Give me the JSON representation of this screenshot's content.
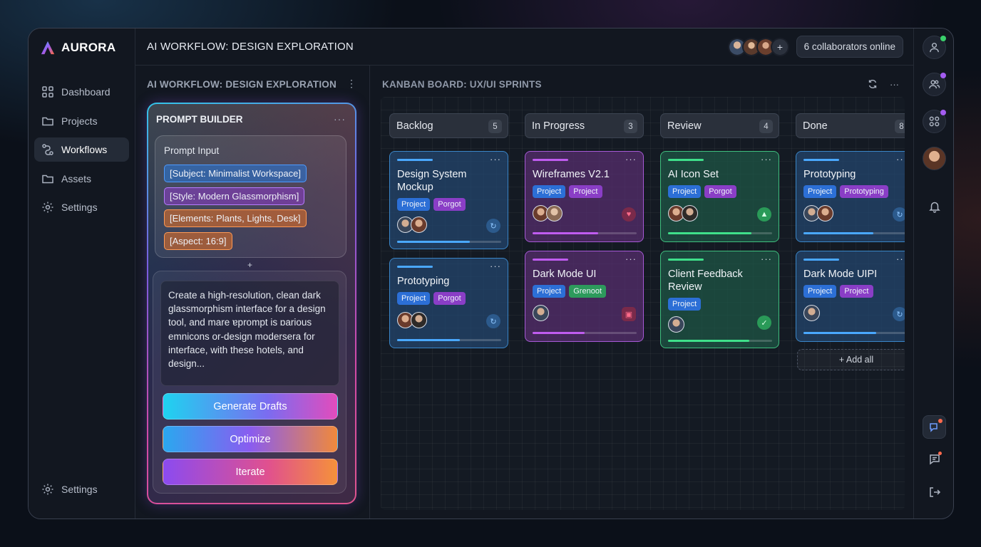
{
  "app": {
    "name": "AURORA"
  },
  "sidebar": {
    "items": [
      {
        "label": "Dashboard",
        "icon": "grid-icon"
      },
      {
        "label": "Projects",
        "icon": "folder-icon"
      },
      {
        "label": "Workflows",
        "icon": "workflow-icon",
        "active": true
      },
      {
        "label": "Assets",
        "icon": "folder-icon"
      },
      {
        "label": "Settings",
        "icon": "gear-icon"
      }
    ],
    "bottom": {
      "label": "Settings",
      "icon": "gear-icon"
    }
  },
  "topbar": {
    "title": "AI WORKFLOW: DESIGN EXPLORATION",
    "add_symbol": "+",
    "collaborators": "6 collaborators online"
  },
  "workflow_panel": {
    "heading": "AI WORKFLOW: DESIGN EXPLORATION",
    "more": "⋮",
    "prompt_builder": {
      "title": "PROMPT BUILDER",
      "more": "···",
      "input_label": "Prompt Input",
      "chips": [
        "[Subject: Minimalist Workspace]",
        "[Style: Modern Glassmorphism]",
        "[Elements: Plants, Lights, Desk]",
        "[Aspect: 16:9]"
      ],
      "add_symbol": "+",
      "prompt_text": "Create a high-resolution, clean dark glassmorphism interface for a design tool, and mare ɐprompt is ɒarious emnicons or-design modersera for interface, with these hotels, and design...",
      "buttons": {
        "generate": "Generate Drafts",
        "optimize": "Optimize",
        "iterate": "Iterate"
      }
    }
  },
  "kanban": {
    "heading": "KANBAN BOARD: UX/UI SPRINTS",
    "more": "···",
    "columns": [
      {
        "name": "Backlog",
        "count": "5"
      },
      {
        "name": "In Progress",
        "count": "3"
      },
      {
        "name": "Review",
        "count": "4"
      },
      {
        "name": "Done",
        "count": "8"
      }
    ],
    "cards": [
      {
        "title": "Design System Mockup",
        "tags": [
          "Project",
          "Porgot"
        ],
        "progress": 0.7
      },
      {
        "title": "Prototyping",
        "tags": [
          "Project",
          "Porgot"
        ],
        "progress": 0.6
      },
      {
        "title": "Wireframes V2.1",
        "tags": [
          "Project",
          "Project"
        ],
        "progress": 0.63
      },
      {
        "title": "Dark Mode UI",
        "tags": [
          "Project",
          "Grenoot"
        ],
        "progress": 0.5
      },
      {
        "title": "AI Icon Set",
        "tags": [
          "Project",
          "Porgot"
        ],
        "progress": 0.8
      },
      {
        "title": "Client Feedback Review",
        "tags": [
          "Project"
        ],
        "progress": 0.78
      },
      {
        "title": "Prototyping",
        "tags": [
          "Project",
          "Prototyping"
        ],
        "progress": 0.67
      },
      {
        "title": "Dark Mode UIPI",
        "tags": [
          "Project",
          "Project"
        ],
        "progress": 0.7
      }
    ],
    "card_more": "···",
    "add_all": "+ Add all"
  },
  "colors": {
    "accent_cyan": "#1ed3f0",
    "accent_pink": "#e24cbc",
    "accent_orange": "#f5913a",
    "online": "#3ad06b",
    "notify": "#a35cf0"
  }
}
